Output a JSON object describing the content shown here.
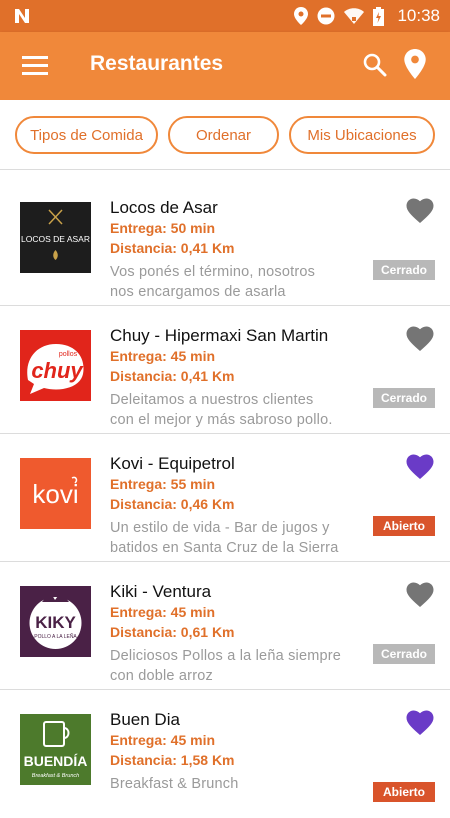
{
  "status_bar": {
    "time": "10:38",
    "icons": [
      "notification-n-icon",
      "location-icon",
      "do-not-disturb-icon",
      "wifi-icon",
      "battery-icon"
    ]
  },
  "app_bar": {
    "title": "Restaurantes",
    "icons": [
      "menu-icon",
      "search-icon",
      "location-pin-icon"
    ]
  },
  "filters": [
    {
      "label": "Tipos de Comida"
    },
    {
      "label": "Ordenar"
    },
    {
      "label": "Mis Ubicaciones"
    }
  ],
  "colors": {
    "primary": "#f0883a",
    "status_bar": "#e0702a",
    "accent_text": "#e0702a",
    "favorite": "#6a3bc7",
    "not_favorite": "#757575",
    "closed_badge": "#b8b8b8",
    "open_badge": "#d9542b"
  },
  "restaurants": [
    {
      "name": "Locos de Asar",
      "delivery": "Entrega: 50 min",
      "distance": "Distancia: 0,41 Km",
      "desc_line1": "Vos ponés el término, nosotros",
      "desc_line2": "nos encargamos de asarla",
      "status": "Cerrado",
      "favorite": false,
      "logo_text": "LOCOS DE ASAR"
    },
    {
      "name": "Chuy - Hipermaxi San Martin",
      "delivery": "Entrega: 45 min",
      "distance": "Distancia: 0,41 Km",
      "desc_line1": "Deleitamos a nuestros clientes",
      "desc_line2": "con el mejor y más sabroso pollo.",
      "status": "Cerrado",
      "favorite": false,
      "logo_text": "chuy"
    },
    {
      "name": "Kovi - Equipetrol",
      "delivery": "Entrega: 55 min",
      "distance": "Distancia: 0,46 Km",
      "desc_line1": "Un estilo de vida - Bar de jugos y",
      "desc_line2": "batidos en Santa Cruz de la Sierra",
      "status": "Abierto",
      "favorite": true,
      "logo_text": "kovi"
    },
    {
      "name": "Kiki - Ventura",
      "delivery": "Entrega: 45 min",
      "distance": "Distancia: 0,61 Km",
      "desc_line1": "Deliciosos Pollos a la leña siempre",
      "desc_line2": "con doble arroz",
      "status": "Cerrado",
      "favorite": false,
      "logo_text": "KIKY"
    },
    {
      "name": "Buen Dia",
      "delivery": "Entrega: 45 min",
      "distance": "Distancia: 1,58 Km",
      "desc_line1": "Breakfast & Brunch",
      "desc_line2": "",
      "status": "Abierto",
      "favorite": true,
      "logo_text": "BUENDÍA"
    }
  ]
}
